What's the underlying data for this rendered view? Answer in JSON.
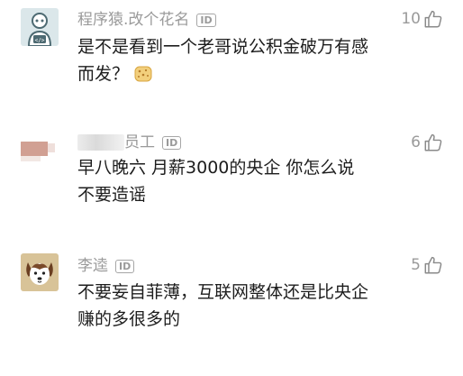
{
  "comments": [
    {
      "username": "程序猿.改个花名",
      "badge": "ID",
      "like_count": "10",
      "content": "是不是看到一个老哥说公积金破万有感\n而发？",
      "emoji": "cookie-emoji",
      "avatar": "robot-avatar"
    },
    {
      "username": "员工",
      "badge": "ID",
      "like_count": "6",
      "content": "早八晚六  月薪3000的央企  你怎么说\n不要造谣",
      "avatar": "blurred-avatar"
    },
    {
      "username": "李逵",
      "badge": "ID",
      "like_count": "5",
      "content": "不要妄自菲薄，互联网整体还是比央企\n赚的多很多的",
      "avatar": "dog-avatar"
    }
  ],
  "colors": {
    "meta_text": "#9a9a9a",
    "body_text": "#1d1d1d",
    "avatar_robot_bg": "#dbe7ea",
    "avatar_dog_bg": "#d8c398"
  }
}
